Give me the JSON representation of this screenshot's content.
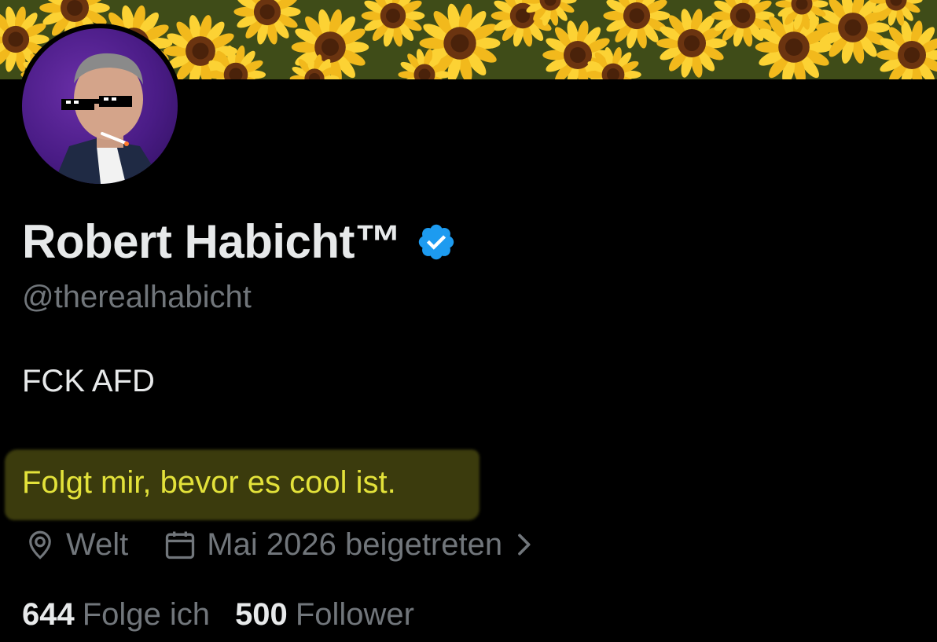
{
  "profile": {
    "display_name": "Robert Habicht™",
    "handle": "@therealhabicht",
    "bio": "FCK AFD",
    "tagline": "Folgt mir, bevor es cool ist.",
    "location": "Welt",
    "joined": "Mai 2026 beigetreten",
    "verified_color": "#1d9bf0"
  },
  "stats": {
    "following_count": "644",
    "following_label": "Folge ich",
    "followers_count": "500",
    "followers_label": "Follower"
  },
  "icons": {
    "verified": "verified-badge-icon",
    "location": "location-pin-icon",
    "calendar": "calendar-icon",
    "chevron": "chevron-right-icon"
  },
  "colors": {
    "background": "#000000",
    "primary_text": "#e7e9ea",
    "secondary_text": "#71767b",
    "highlight_text": "#e3e23a"
  }
}
